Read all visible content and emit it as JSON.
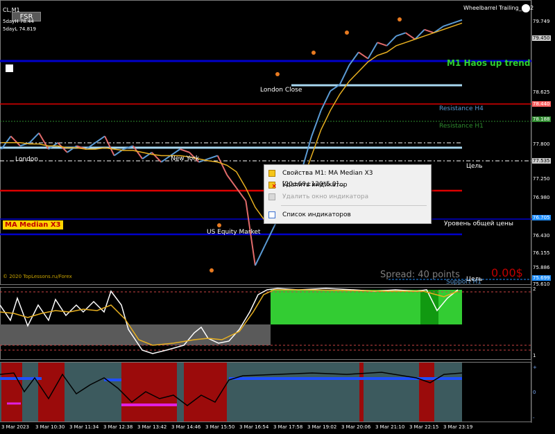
{
  "header": {
    "symbol": "CL,M1",
    "fsr_button": "FSR",
    "five_day_high": "5dayH 78.44",
    "five_day_low": "5dayL 74.819",
    "ea_name": "Wheelbarrel Trailing_v1.2"
  },
  "chart_labels": {
    "trend": "M1 Haos up trend",
    "london": "London",
    "new_york": "New York",
    "london_close": "London Close",
    "us_equity": "US Equity Market",
    "resistance_h4": "Resistance H4",
    "resistance_h1": "Resistance H1",
    "target": "Цель",
    "common_price_level": "Уровень общей цены",
    "support_h1": "Support H1",
    "target2": "Цель",
    "ma_median": "MA Median X3",
    "spread": "Spread: 40 points",
    "percent": "0.00$",
    "copyright": "© 2020 TopLessons.ru/Forex"
  },
  "price_axis": {
    "main": [
      "79.749",
      "79.450",
      "78.625",
      "78.440",
      "78.188",
      "77.800",
      "77.535",
      "77.250",
      "76.980",
      "76.705",
      "76.430",
      "76.155",
      "75.886",
      "75.699",
      "75.610"
    ],
    "osc": [
      "2",
      "1"
    ],
    "osc2": [
      "+",
      "0",
      "-"
    ]
  },
  "colors": {
    "resistance_h4": "#ff4040",
    "resistance_h1": "#2e8b2e",
    "support": "#1f8fff",
    "trend": "#2fd12f",
    "price_up": "#5b9bd5",
    "price_down": "#e26b6b",
    "ma_line": "#e8b020",
    "blue_level": "#0000cc",
    "red_level": "#dd0000",
    "light_level": "#a8d8f0"
  },
  "context_menu": {
    "items": [
      {
        "icon": "indicator-properties-icon",
        "label": "Свойства M1: MA Median X3 [20±60±120*5.0]...",
        "enabled": true
      },
      {
        "icon": "delete-indicator-icon",
        "label": "Удалить индикатор",
        "enabled": true
      },
      {
        "icon": "delete-window-icon",
        "label": "Удалить окно индикатора",
        "enabled": false
      },
      {
        "icon": "indicator-list-icon",
        "label": "Список индикаторов",
        "enabled": true
      }
    ]
  },
  "time_axis": [
    "3 Mar 2023",
    "3 Mar 10:30",
    "3 Mar 11:34",
    "3 Mar 12:38",
    "3 Mar 13:42",
    "3 Mar 14:46",
    "3 Mar 15:50",
    "3 Mar 16:54",
    "3 Mar 17:58",
    "3 Mar 19:02",
    "3 Mar 20:06",
    "3 Mar 21:10",
    "3 Mar 22:15",
    "3 Mar 23:19"
  ],
  "chart_data": {
    "type": "line",
    "title": "CL,M1",
    "price_series": {
      "name": "CL",
      "values": [
        77.7,
        77.9,
        77.75,
        77.8,
        77.95,
        77.7,
        77.8,
        77.65,
        77.75,
        77.7,
        77.8,
        77.9,
        77.6,
        77.7,
        77.75,
        77.55,
        77.65,
        77.5,
        77.6,
        77.7,
        77.65,
        77.5,
        77.55,
        77.6,
        77.3,
        77.1,
        76.9,
        75.9,
        76.2,
        76.5,
        76.8,
        77.0,
        77.4,
        77.9,
        78.3,
        78.6,
        78.7,
        79.0,
        79.2,
        79.1,
        79.35,
        79.3,
        79.45,
        79.5,
        79.4,
        79.55,
        79.5,
        79.6,
        79.65,
        79.7
      ]
    },
    "ma_series": {
      "name": "MA Median X3",
      "values": [
        77.8,
        77.8,
        77.8,
        77.78,
        77.78,
        77.75,
        77.75,
        77.72,
        77.72,
        77.7,
        77.7,
        77.72,
        77.7,
        77.68,
        77.68,
        77.65,
        77.62,
        77.6,
        77.6,
        77.6,
        77.58,
        77.55,
        77.52,
        77.5,
        77.45,
        77.35,
        77.1,
        76.8,
        76.6,
        76.6,
        76.75,
        76.95,
        77.2,
        77.6,
        78.0,
        78.3,
        78.55,
        78.75,
        78.9,
        79.05,
        79.15,
        79.2,
        79.3,
        79.35,
        79.4,
        79.45,
        79.5,
        79.55,
        79.6,
        79.65
      ]
    },
    "levels": [
      {
        "name": "Resistance H4",
        "value": 78.44
      },
      {
        "name": "Resistance H1",
        "value": 78.188
      },
      {
        "name": "Цель",
        "value": 77.535
      },
      {
        "name": "Уровень общей цены",
        "value": 76.705
      },
      {
        "name": "Support H1",
        "value": 75.699
      }
    ],
    "ylim": [
      75.61,
      79.9
    ]
  }
}
